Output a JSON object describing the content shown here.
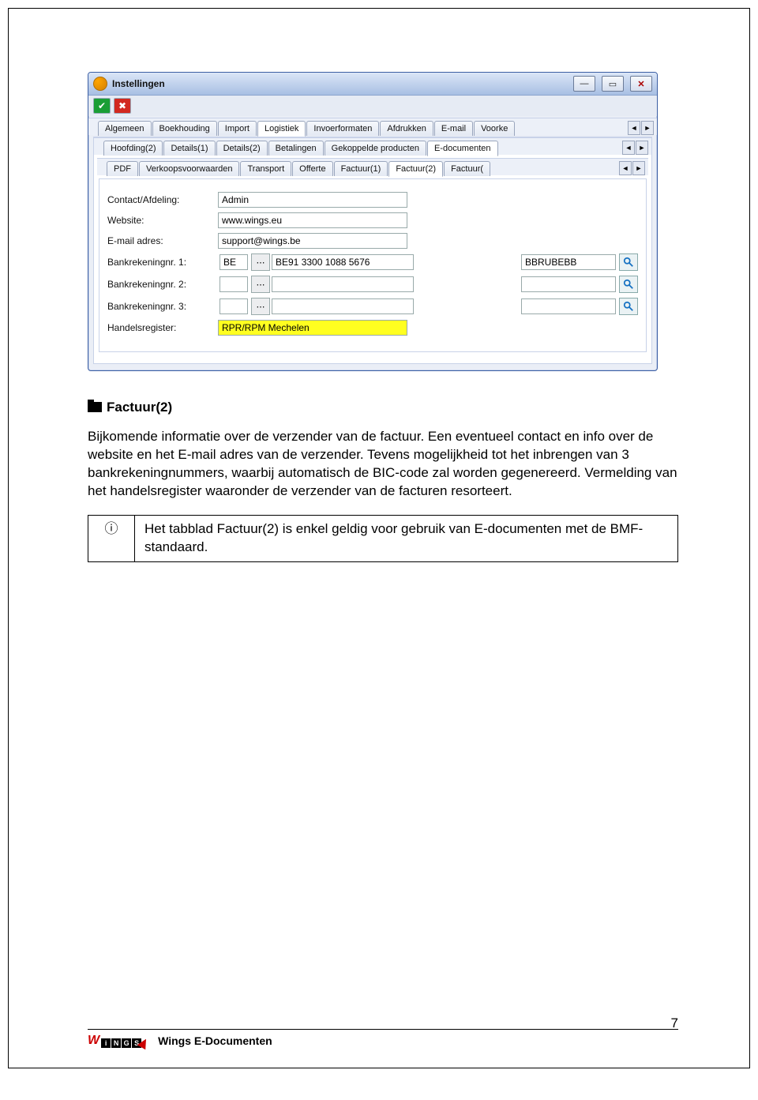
{
  "window": {
    "title": "Instellingen",
    "tabs_level1": [
      "Algemeen",
      "Boekhouding",
      "Import",
      "Logistiek",
      "Invoerformaten",
      "Afdrukken",
      "E-mail",
      "Voorke"
    ],
    "tabs_level1_active": 3,
    "tabs_level2": [
      "Hoofding(2)",
      "Details(1)",
      "Details(2)",
      "Betalingen",
      "Gekoppelde producten",
      "E-documenten"
    ],
    "tabs_level2_active": 5,
    "tabs_level3": [
      "PDF",
      "Verkoopsvoorwaarden",
      "Transport",
      "Offerte",
      "Factuur(1)",
      "Factuur(2)",
      "Factuur("
    ],
    "tabs_level3_active": 5,
    "form": {
      "labels": {
        "contact": "Contact/Afdeling:",
        "website": "Website:",
        "email": "E-mail adres:",
        "bank1": "Bankrekeningnr. 1:",
        "bank2": "Bankrekeningnr. 2:",
        "bank3": "Bankrekeningnr. 3:",
        "register": "Handelsregister:"
      },
      "values": {
        "contact": "Admin",
        "website": "www.wings.eu",
        "email": "support@wings.be",
        "bank1_country": "BE",
        "bank1_iban": "BE91 3300 1088 5676",
        "bank1_bic": "BBRUBEBB",
        "register": "RPR/RPM Mechelen"
      }
    }
  },
  "doc": {
    "section_title": "Factuur(2)",
    "body_paragraph": "Bijkomende informatie over de verzender van de factuur. Een eventueel contact en info over de website en het E-mail adres van de verzender. Tevens mogelijkheid tot het inbrengen van 3 bankrekeningnummers, waarbij automatisch de BIC-code zal worden gegenereerd. Vermelding van het handelsregister waaronder de verzender van de facturen resorteert.",
    "info_box": "Het tabblad Factuur(2) is enkel geldig voor gebruik van E-documenten met de BMF-standaard."
  },
  "footer": {
    "title": "Wings E-Documenten",
    "page_number": "7",
    "logo_letters": [
      "i",
      "N",
      "G",
      "S"
    ]
  }
}
